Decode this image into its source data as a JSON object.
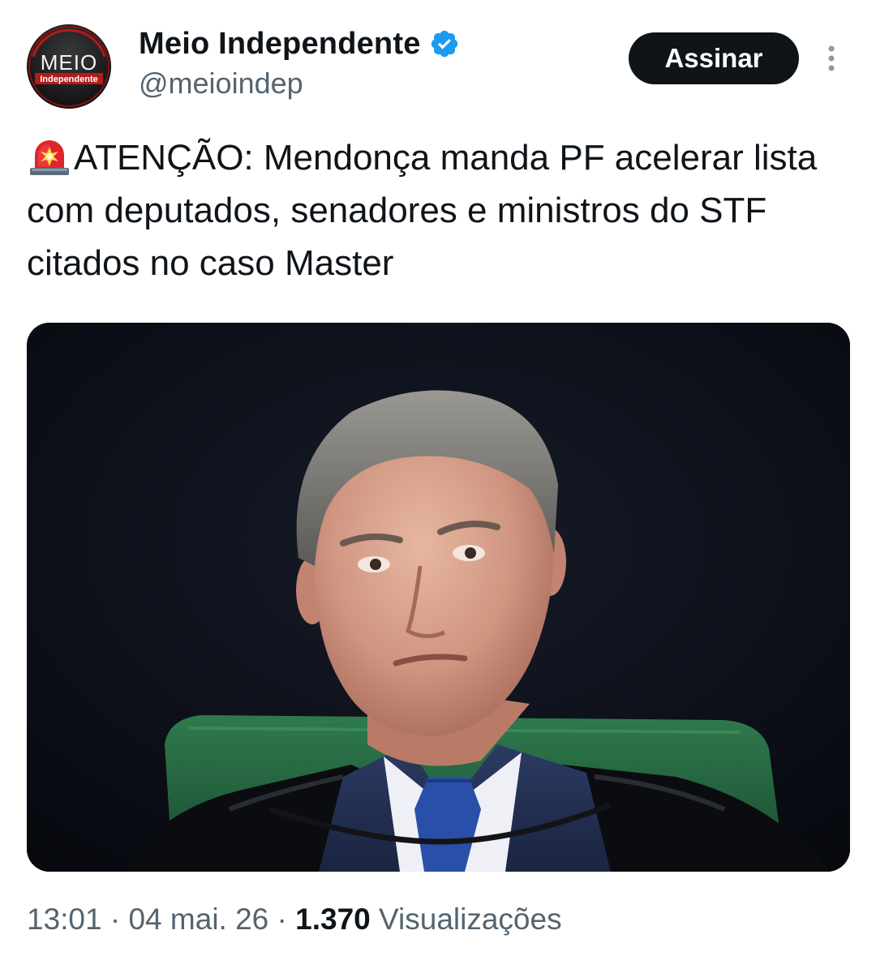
{
  "author": {
    "display_name": "Meio Independente",
    "handle": "@meioindep",
    "verified_icon": "verified-badge-icon",
    "avatar_logo_text": "MEIO",
    "avatar_logo_subtext": "Independente"
  },
  "actions": {
    "subscribe_label": "Assinar",
    "more_icon": "more-vertical-icon"
  },
  "tweet": {
    "emoji_icon": "rotating-light-icon",
    "text": "ATENÇÃO: Mendonça manda PF acelerar lista com deputados, senadores e ministros do STF citados no caso Master"
  },
  "media": {
    "type": "photo"
  },
  "meta": {
    "time": "13:01",
    "separator": "·",
    "date": "04 mai. 26",
    "views_count": "1.370",
    "views_label": "Visualizações"
  },
  "colors": {
    "text_primary": "#0f1419",
    "text_secondary": "#536471",
    "verified_blue": "#1d9bf0",
    "button_bg": "#0f1419"
  }
}
